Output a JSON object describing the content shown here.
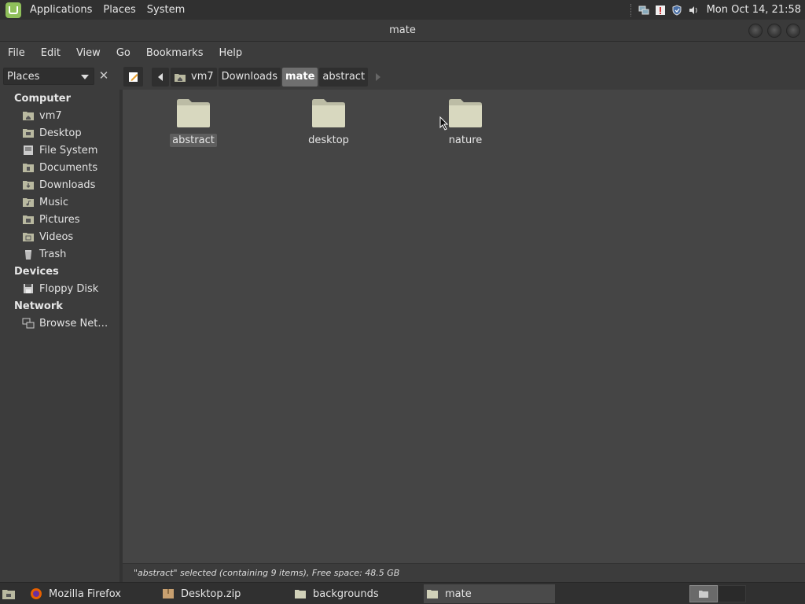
{
  "top_panel": {
    "menus": [
      "Applications",
      "Places",
      "System"
    ],
    "clock": "Mon Oct 14, 21:58",
    "tray_icons": [
      "network-icon",
      "update-icon",
      "shield-icon",
      "volume-icon"
    ]
  },
  "window": {
    "title": "mate"
  },
  "menubar": [
    "File",
    "Edit",
    "View",
    "Go",
    "Bookmarks",
    "Help"
  ],
  "toolbar": {
    "places_combo": "Places",
    "breadcrumbs": [
      "vm7",
      "Downloads",
      "mate",
      "abstract"
    ],
    "active_crumb": "mate"
  },
  "sidebar": {
    "computer_header": "Computer",
    "computer_items": [
      {
        "label": "vm7",
        "icon": "home-folder-icon"
      },
      {
        "label": "Desktop",
        "icon": "desktop-folder-icon"
      },
      {
        "label": "File System",
        "icon": "drive-icon"
      },
      {
        "label": "Documents",
        "icon": "documents-folder-icon"
      },
      {
        "label": "Downloads",
        "icon": "downloads-folder-icon"
      },
      {
        "label": "Music",
        "icon": "music-folder-icon"
      },
      {
        "label": "Pictures",
        "icon": "pictures-folder-icon"
      },
      {
        "label": "Videos",
        "icon": "videos-folder-icon"
      },
      {
        "label": "Trash",
        "icon": "trash-icon"
      }
    ],
    "devices_header": "Devices",
    "devices_items": [
      {
        "label": "Floppy Disk",
        "icon": "floppy-icon"
      }
    ],
    "network_header": "Network",
    "network_items": [
      {
        "label": "Browse Net…",
        "icon": "network-icon"
      }
    ]
  },
  "files": [
    {
      "name": "abstract",
      "selected": true
    },
    {
      "name": "desktop",
      "selected": false
    },
    {
      "name": "nature",
      "selected": false
    }
  ],
  "statusbar": {
    "text": "\"abstract\" selected (containing 9 items), Free space: 48.5 GB"
  },
  "taskbar": {
    "tasks": [
      {
        "label": "Mozilla Firefox",
        "icon": "firefox-icon"
      },
      {
        "label": "Desktop.zip",
        "icon": "archive-icon"
      },
      {
        "label": "backgrounds",
        "icon": "folder-icon"
      },
      {
        "label": "mate",
        "icon": "folder-icon",
        "active": true
      }
    ]
  },
  "colors": {
    "folder": "#d8d8bf",
    "panel": "#303030",
    "window_bg": "#3c3c3c",
    "view_bg": "#454545",
    "mint_green": "#8fbf5a"
  }
}
